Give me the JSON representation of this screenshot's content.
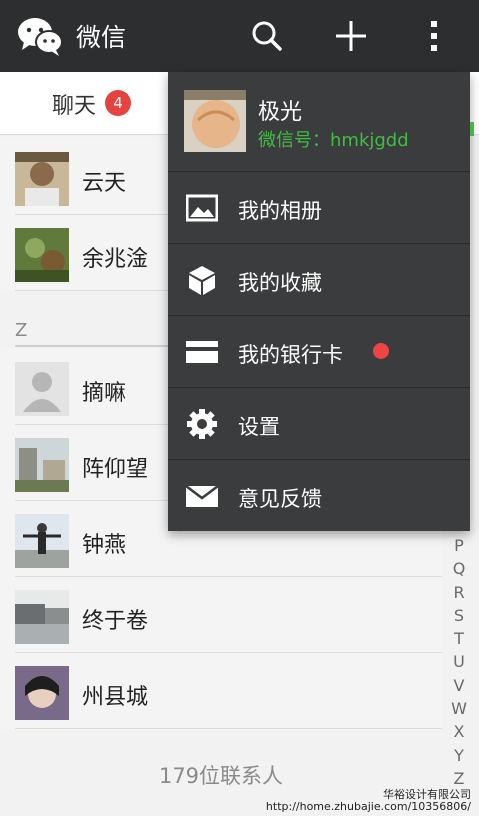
{
  "header": {
    "title": "微信"
  },
  "tabs": {
    "chat_label": "聊天",
    "chat_badge": "4"
  },
  "contacts": [
    {
      "name": "云天"
    },
    {
      "name": "余兆淦"
    },
    {
      "name": "摘嘛"
    },
    {
      "name": "阵仰望"
    },
    {
      "name": "钟燕"
    },
    {
      "name": "终于卷"
    },
    {
      "name": "州县城"
    }
  ],
  "section_letter": "Z",
  "alphabet_index": [
    "P",
    "Q",
    "R",
    "S",
    "T",
    "U",
    "V",
    "W",
    "X",
    "Y",
    "Z"
  ],
  "contact_count": "179位联系人",
  "menu": {
    "profile_name": "极光",
    "profile_id": "微信号：hmkjgdd",
    "items": [
      {
        "label": "我的相册",
        "icon": "photo-album-icon"
      },
      {
        "label": "我的收藏",
        "icon": "favorites-box-icon"
      },
      {
        "label": "我的银行卡",
        "icon": "bank-card-icon"
      },
      {
        "label": "设置",
        "icon": "gear-icon"
      },
      {
        "label": "意见反馈",
        "icon": "envelope-icon"
      }
    ]
  },
  "watermark": {
    "line1": "华裕设计有限公司",
    "line2": "http://home.zhubajie.com/10356806/"
  },
  "colors": {
    "topbar": "#2d2e30",
    "menu": "#3b3c3e",
    "accent_green": "#3fbf3f",
    "badge_red": "#e64340"
  }
}
